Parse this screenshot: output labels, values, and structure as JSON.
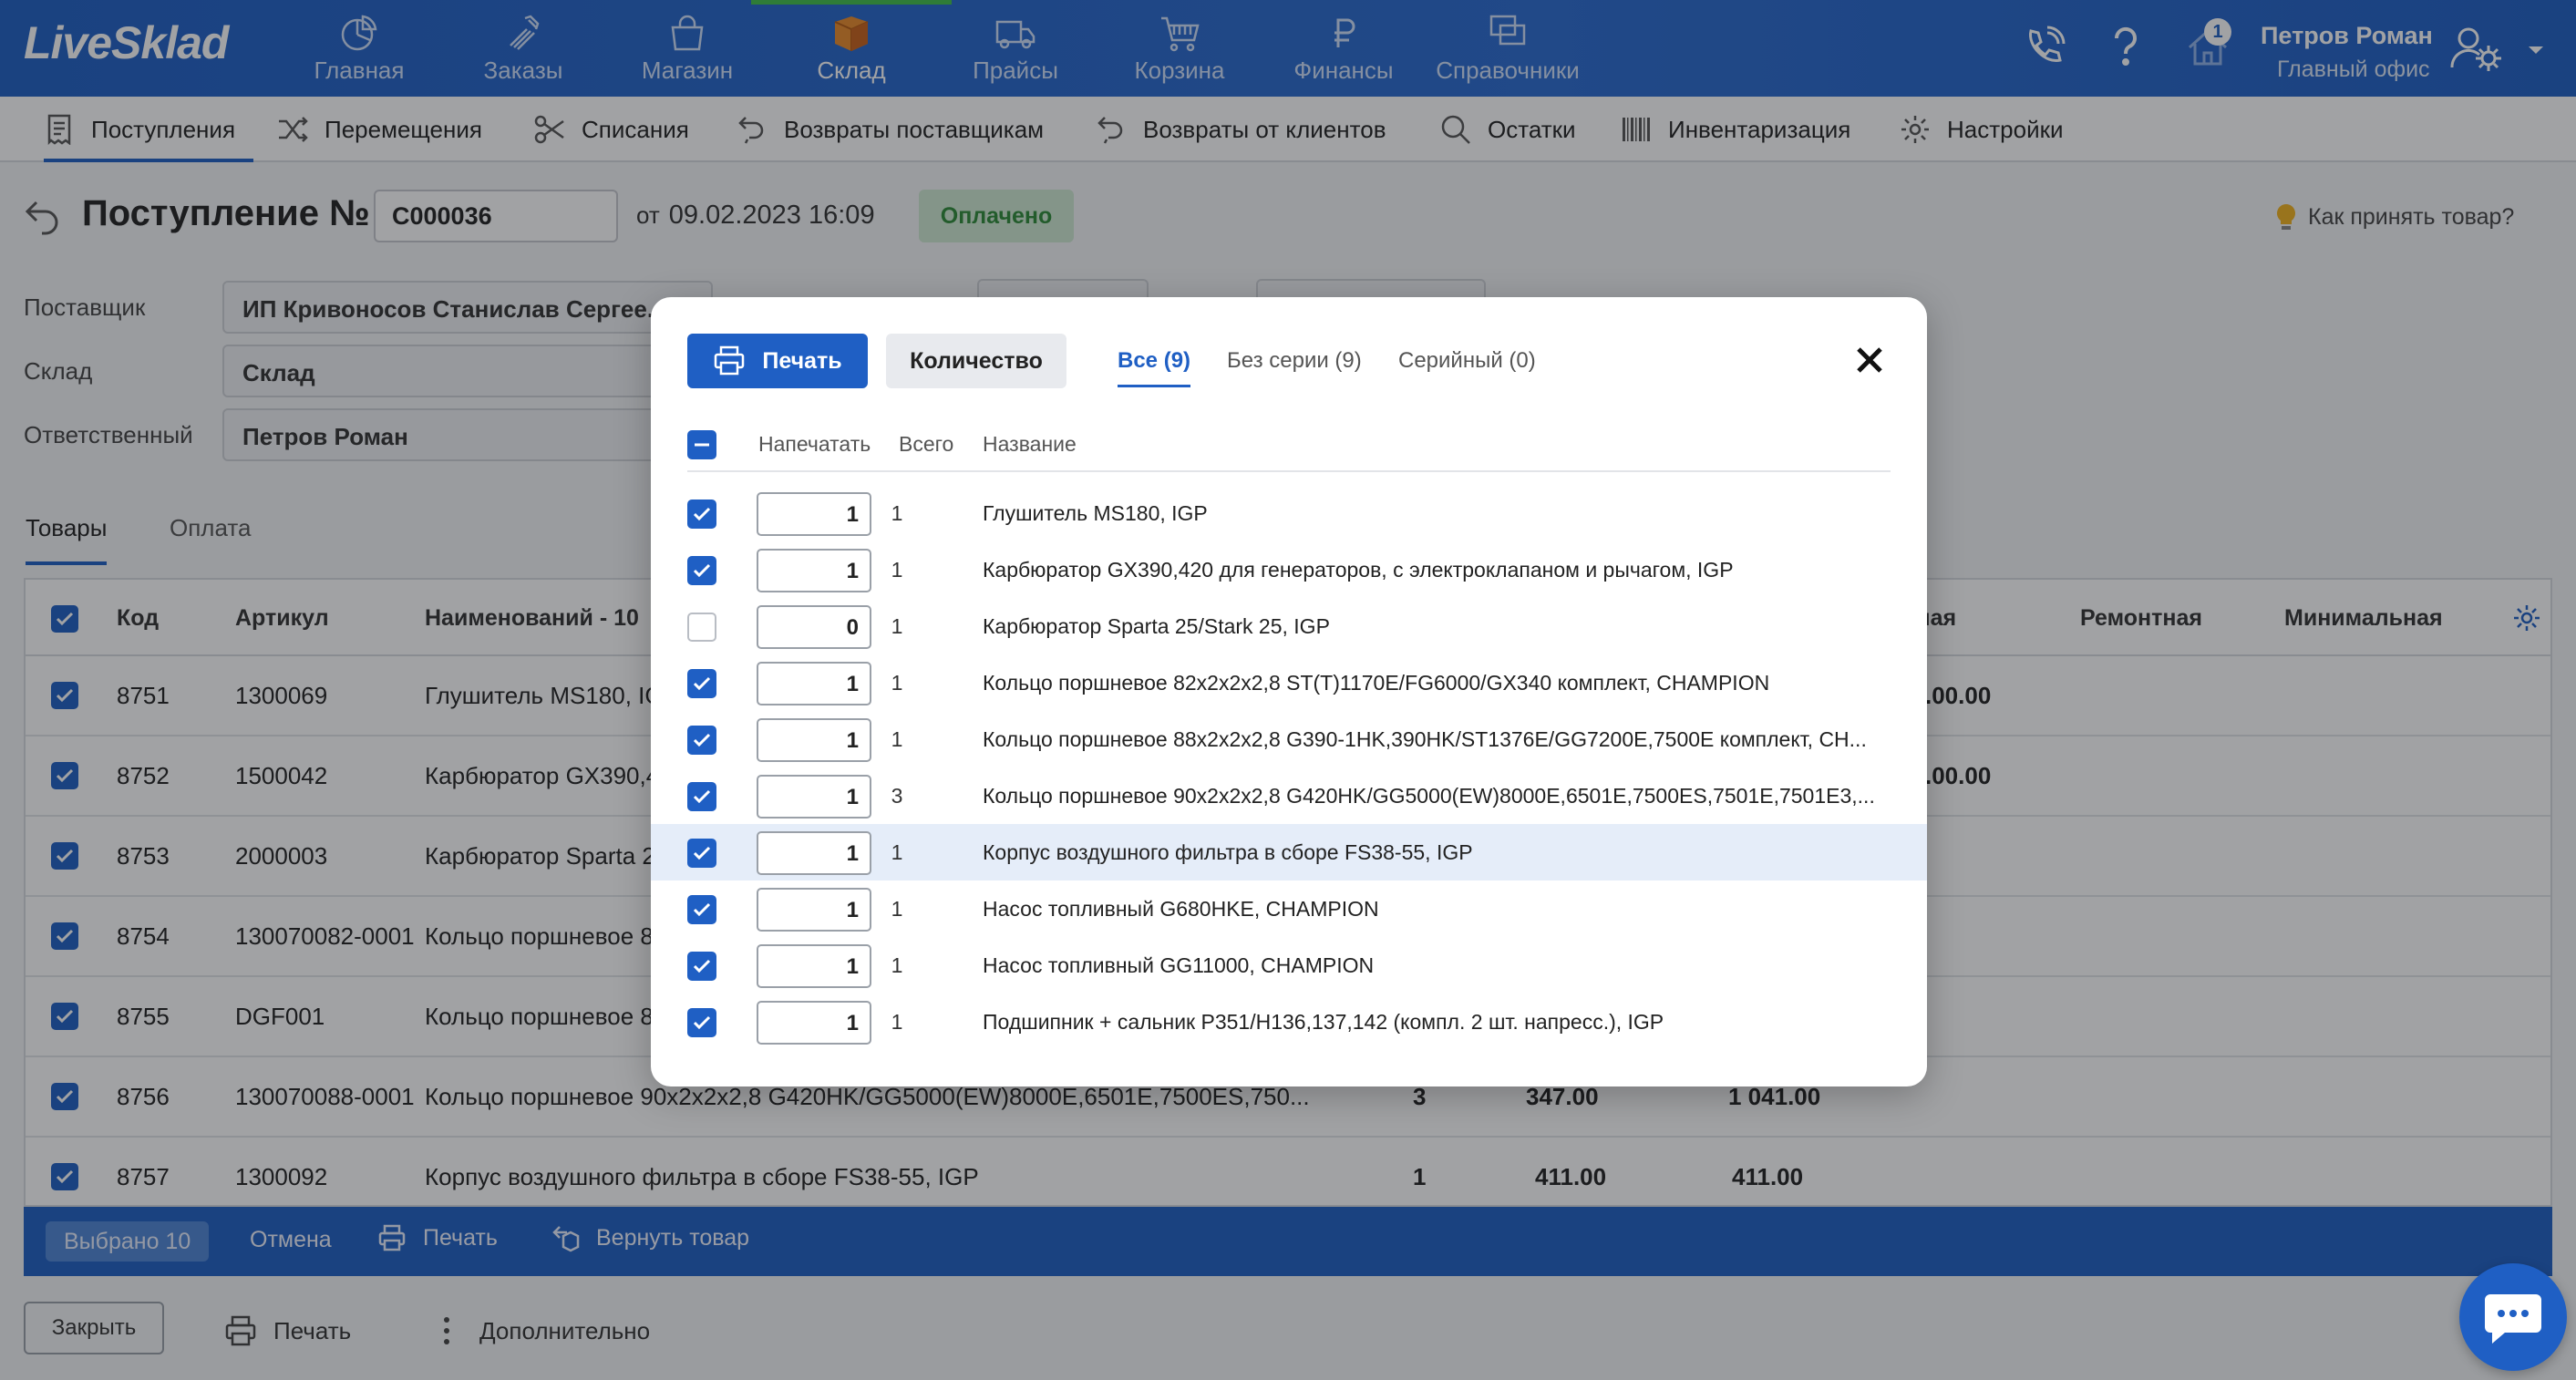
{
  "brand": {
    "logo": "LiveSklad",
    "accent": "#1f5fc4",
    "active_marker": "#41c04c"
  },
  "topnav": {
    "items": [
      {
        "label": "Главная",
        "icon": "pie-chart-icon"
      },
      {
        "label": "Заказы",
        "icon": "tools-icon"
      },
      {
        "label": "Магазин",
        "icon": "shopping-bag-icon"
      },
      {
        "label": "Склад",
        "icon": "box-icon",
        "active": true
      },
      {
        "label": "Прайсы",
        "icon": "truck-icon"
      },
      {
        "label": "Корзина",
        "icon": "cart-icon"
      },
      {
        "label": "Финансы",
        "icon": "ruble-icon"
      },
      {
        "label": "Справочники",
        "icon": "windows-icon"
      }
    ],
    "notification_count": "1",
    "user": {
      "name": "Петров Роман",
      "office": "Главный офис"
    }
  },
  "subnav": {
    "items": [
      {
        "label": "Поступления",
        "icon": "receipt-icon",
        "active": true
      },
      {
        "label": "Перемещения",
        "icon": "shuffle-icon"
      },
      {
        "label": "Списания",
        "icon": "scissors-icon"
      },
      {
        "label": "Возвраты поставщикам",
        "icon": "return-icon"
      },
      {
        "label": "Возвраты от клиентов",
        "icon": "return-icon"
      },
      {
        "label": "Остатки",
        "icon": "search-icon"
      },
      {
        "label": "Инвентаризация",
        "icon": "barcode-icon"
      },
      {
        "label": "Настройки",
        "icon": "gear-icon"
      }
    ]
  },
  "doc": {
    "title": "Поступление №",
    "number": "С000036",
    "date_prefix": "от",
    "date": "09.02.2023 16:09",
    "status": "Оплачено",
    "help": "Как принять товар?"
  },
  "form": {
    "supplier_label": "Поставщик",
    "supplier_value": "ИП Кривоносов Станислав Сергее...",
    "warehouse_label": "Склад",
    "warehouse_value": "Склад",
    "responsible_label": "Ответственный",
    "responsible_value": "Петров Роман"
  },
  "tabs": {
    "goods": "Товары",
    "payment": "Оплата"
  },
  "table": {
    "headers": {
      "code": "Код",
      "article": "Артикул",
      "name": "Наименований - 10",
      "retail": "чная",
      "repair": "Ремонтная",
      "min": "Минимальная"
    },
    "rows": [
      {
        "code": "8751",
        "article": "1300069",
        "name": "Глушитель MS180, IG",
        "qty": "",
        "price": "",
        "sum": "",
        "retail": ".00.00"
      },
      {
        "code": "8752",
        "article": "1500042",
        "name": "Карбюратор GX390,4",
        "qty": "",
        "price": "",
        "sum": "",
        "retail": ".00.00"
      },
      {
        "code": "8753",
        "article": "2000003",
        "name": "Карбюратор Sparta 2",
        "qty": "",
        "price": "",
        "sum": "",
        "retail": ""
      },
      {
        "code": "8754",
        "article": "130070082-0001",
        "name": "Кольцо поршневое 8",
        "qty": "",
        "price": "",
        "sum": "",
        "retail": ""
      },
      {
        "code": "8755",
        "article": "DGF001",
        "name": "Кольцо поршневое 8",
        "qty": "",
        "price": "",
        "sum": "",
        "retail": ""
      },
      {
        "code": "8756",
        "article": "130070088-0001",
        "name": "Кольцо поршневое 90x2x2x2,8 G420HK/GG5000(EW)8000E,6501E,7500ES,750...",
        "qty": "3",
        "price": "347.00",
        "sum": "1 041.00",
        "retail": ""
      },
      {
        "code": "8757",
        "article": "1300092",
        "name": "Корпус воздушного фильтра в сборе FS38-55, IGP",
        "qty": "1",
        "price": "411.00",
        "sum": "411.00",
        "retail": ""
      }
    ]
  },
  "action_bar": {
    "selected": "Выбрано 10",
    "cancel": "Отмена",
    "print": "Печать",
    "return": "Вернуть товар"
  },
  "bottom": {
    "close": "Закрыть",
    "print": "Печать",
    "more": "Дополнительно"
  },
  "modal": {
    "print_button": "Печать",
    "quantity_button": "Количество",
    "tabs": {
      "all": "Все (9)",
      "no_serial": "Без серии (9)",
      "serial": "Серийный (0)"
    },
    "headers": {
      "print": "Напечатать",
      "total": "Всего",
      "name": "Название"
    },
    "rows": [
      {
        "checked": true,
        "print": "1",
        "total": "1",
        "name": "Глушитель MS180, IGP"
      },
      {
        "checked": true,
        "print": "1",
        "total": "1",
        "name": "Карбюратор GX390,420 для генераторов, с электроклапаном и рычагом, IGP"
      },
      {
        "checked": false,
        "print": "0",
        "total": "1",
        "name": "Карбюратор Sparta 25/Stark 25, IGP"
      },
      {
        "checked": true,
        "print": "1",
        "total": "1",
        "name": "Кольцо поршневое 82x2x2x2,8 ST(T)1170E/FG6000/GX340 комплект, CHAMPION"
      },
      {
        "checked": true,
        "print": "1",
        "total": "1",
        "name": "Кольцо поршневое 88x2x2x2,8 G390-1HK,390HK/ST1376E/GG7200E,7500E комплект, CH..."
      },
      {
        "checked": true,
        "print": "1",
        "total": "3",
        "name": "Кольцо поршневое 90x2x2x2,8 G420HK/GG5000(EW)8000E,6501E,7500ES,7501E,7501E3,..."
      },
      {
        "checked": true,
        "print": "1",
        "total": "1",
        "name": "Корпус воздушного фильтра в сборе FS38-55, IGP",
        "highlight": true
      },
      {
        "checked": true,
        "print": "1",
        "total": "1",
        "name": "Насос топливный G680HKE, CHAMPION"
      },
      {
        "checked": true,
        "print": "1",
        "total": "1",
        "name": "Насос топливный GG11000, CHAMPION"
      },
      {
        "checked": true,
        "print": "1",
        "total": "1",
        "name": "Подшипник + сальник P351/H136,137,142 (компл. 2 шт. напресс.), IGP"
      }
    ]
  }
}
